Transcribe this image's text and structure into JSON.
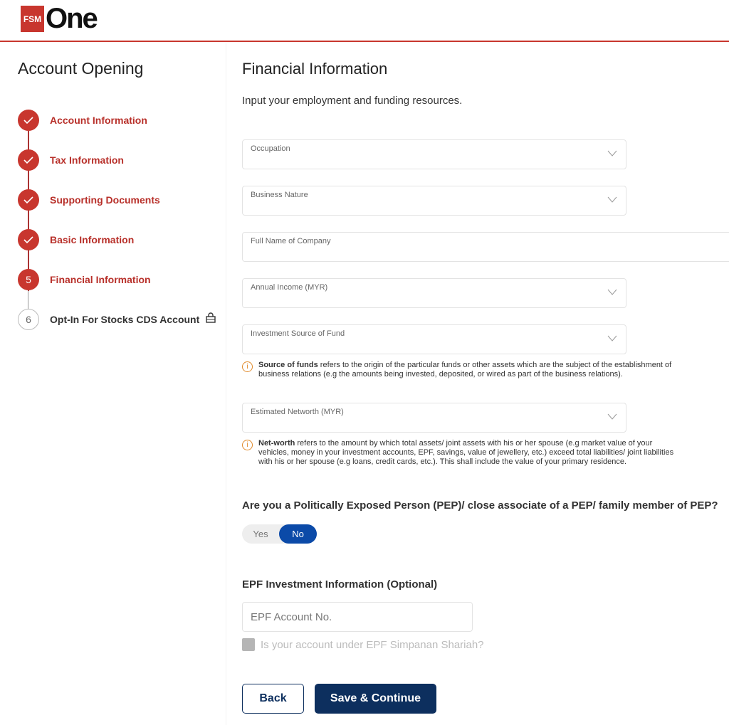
{
  "brand": {
    "logo_box": "FSM",
    "logo_text": "One",
    "accent": "#c8362e",
    "primary": "#0d2f5e"
  },
  "sidebar": {
    "title": "Account Opening",
    "steps": [
      {
        "number": "1",
        "label": "Account Information",
        "status": "done"
      },
      {
        "number": "2",
        "label": "Tax Information",
        "status": "done"
      },
      {
        "number": "3",
        "label": "Supporting Documents",
        "status": "done"
      },
      {
        "number": "4",
        "label": "Basic Information",
        "status": "done"
      },
      {
        "number": "5",
        "label": "Financial Information",
        "status": "current"
      },
      {
        "number": "6",
        "label": "Opt-In For Stocks CDS Account",
        "status": "locked"
      }
    ]
  },
  "main": {
    "title": "Financial Information",
    "subtitle": "Input your employment and funding resources.",
    "fields": {
      "occupation": "Occupation",
      "business_nature": "Business Nature",
      "company": "Full Name of Company",
      "annual_income": "Annual Income (MYR)",
      "source_of_fund": "Investment Source of Fund",
      "networth": "Estimated Networth (MYR)"
    },
    "source_info": {
      "bold": "Source of funds",
      "text": " refers to the origin of the particular funds or other assets which are the subject of the establishment of business relations (e.g the amounts being invested, deposited, or wired as part of the business relations)."
    },
    "networth_info": {
      "bold": "Net-worth",
      "text": " refers to the amount by which total assets/ joint assets with his or her spouse (e.g market value of your vehicles, money in your investment accounts, EPF, savings, value of jewellery, etc.) exceed total liabilities/ joint liabilities with his or her spouse (e.g loans, credit cards, etc.). This shall include the value of your primary residence."
    },
    "pep_question": "Are you a Politically Exposed Person (PEP)/ close associate of a PEP/ family member of PEP?",
    "pep_yes": "Yes",
    "pep_no": "No",
    "pep_selected": "No",
    "epf_heading": "EPF Investment Information (Optional)",
    "epf_placeholder": "EPF Account No.",
    "epf_shariah": "Is your account under EPF Simpanan Shariah?",
    "back": "Back",
    "save": "Save & Continue"
  }
}
